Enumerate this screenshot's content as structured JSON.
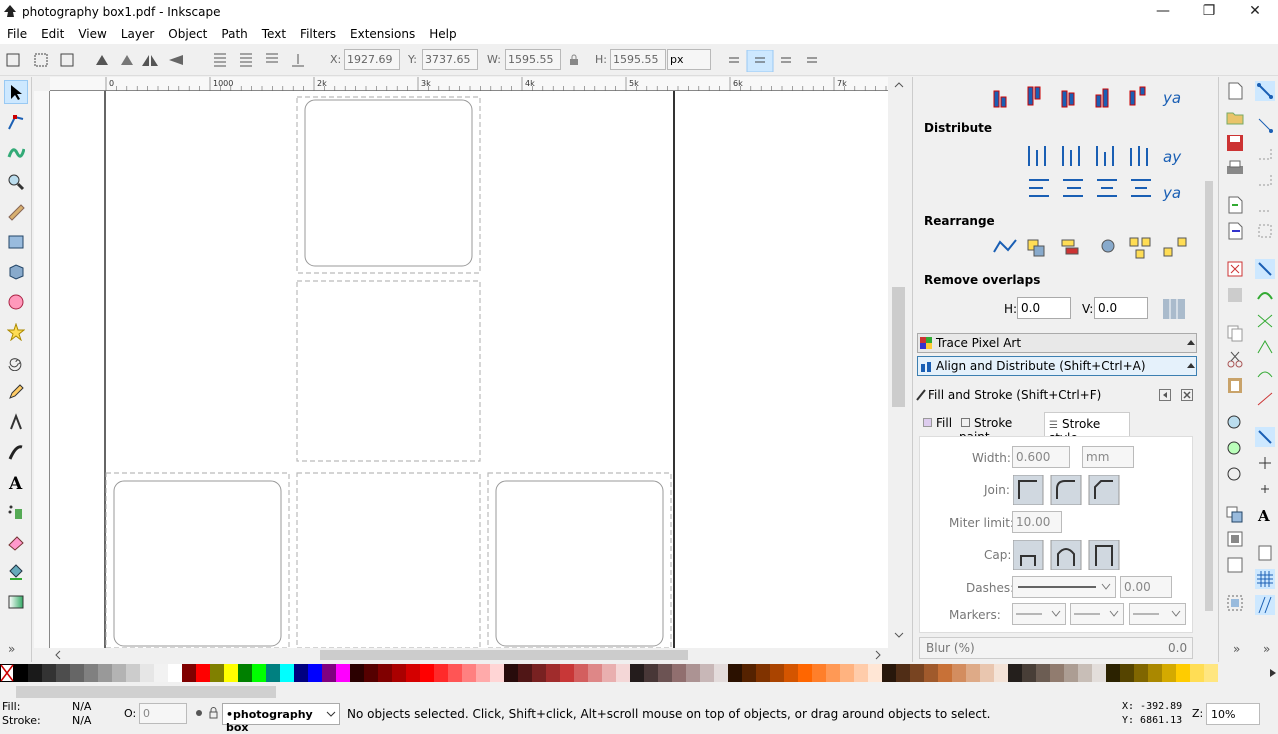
{
  "window": {
    "title": "photography box1.pdf - Inkscape",
    "minimize": "—",
    "maximize": "❐",
    "close": "✕"
  },
  "menu": [
    "File",
    "Edit",
    "View",
    "Layer",
    "Object",
    "Path",
    "Text",
    "Filters",
    "Extensions",
    "Help"
  ],
  "toolbar": {
    "x_label": "X:",
    "x_value": "1927.69",
    "y_label": "Y:",
    "y_value": "3737.65",
    "w_label": "W:",
    "w_value": "1595.55",
    "h_label": "H:",
    "h_value": "1595.55",
    "unit": "px"
  },
  "ruler": {
    "h_ticks": [
      "0",
      "1000",
      "2k",
      "3k",
      "4k",
      "5k",
      "6k",
      "7k"
    ],
    "v_ticks": [
      "7",
      "",
      "",
      ""
    ]
  },
  "dock": {
    "align": {
      "distribute": "Distribute",
      "rearrange": "Rearrange",
      "remove_overlaps": "Remove overlaps",
      "h_label": "H:",
      "h_value": "0.0",
      "v_label": "V:",
      "v_value": "0.0"
    },
    "trace_panel": "Trace Pixel Art",
    "align_panel": "Align and Distribute (Shift+Ctrl+A)",
    "fill_stroke": {
      "title": "Fill and Stroke (Shift+Ctrl+F)",
      "tabs": [
        "Fill",
        "Stroke paint",
        "Stroke style"
      ],
      "width_label": "Width:",
      "width_value": "0.600",
      "width_unit": "mm",
      "join_label": "Join:",
      "miter_label": "Miter limit:",
      "miter_value": "10.00",
      "cap_label": "Cap:",
      "dashes_label": "Dashes:",
      "dashes_value": "0.00",
      "markers_label": "Markers:",
      "blur_label": "Blur (%)",
      "blur_value": "0.0"
    }
  },
  "status": {
    "fill_label": "Fill:",
    "fill_value": "N/A",
    "stroke_label": "Stroke:",
    "stroke_value": "N/A",
    "opacity_label": "O:",
    "opacity_value": "0",
    "layer": "•photography box",
    "message": "No objects selected. Click, Shift+click, Alt+scroll mouse on top of objects, or drag around objects to select.",
    "x_coord": "X: -392.89",
    "y_coord": "Y: 6861.13",
    "zoom_label": "Z:",
    "zoom_value": "10%"
  },
  "colors": {
    "accent": "#cde8ff",
    "palette_bar": "#f0f0f0"
  },
  "palette": [
    "#000000",
    "#1a1a1a",
    "#333333",
    "#4d4d4d",
    "#666666",
    "#808080",
    "#999999",
    "#b3b3b3",
    "#cccccc",
    "#e6e6e6",
    "#f2f2f2",
    "#ffffff",
    "#800000",
    "#ff0000",
    "#808000",
    "#ffff00",
    "#008000",
    "#00ff00",
    "#008080",
    "#00ffff",
    "#000080",
    "#0000ff",
    "#800080",
    "#ff00ff",
    "#2b0000",
    "#550000",
    "#800000",
    "#aa0000",
    "#d40000",
    "#ff0000",
    "#ff2a2a",
    "#ff5555",
    "#ff8080",
    "#ffaaaa",
    "#ffd5d5",
    "#280b0b",
    "#501616",
    "#782121",
    "#a02c2c",
    "#c83737",
    "#d35f5f",
    "#de8787",
    "#e9afaf",
    "#f4d7d7",
    "#241c1c",
    "#483737",
    "#6c5353",
    "#916f6f",
    "#ac9393",
    "#c8b7b7",
    "#e3dbdb",
    "#2b1100",
    "#552200",
    "#803300",
    "#aa4400",
    "#d45500",
    "#ff6600",
    "#ff7f2a",
    "#ff9955",
    "#ffb380",
    "#ffccaa",
    "#ffe6d5",
    "#28170b",
    "#502d16",
    "#784421",
    "#a05a2c",
    "#c87137",
    "#d38d5f",
    "#deaa87",
    "#e9c6af",
    "#f4e3d7",
    "#241f1c",
    "#483e37",
    "#6c5d53",
    "#917c6f",
    "#ac9d93",
    "#c8beb7",
    "#e3dedb",
    "#2b2200",
    "#554400",
    "#806600",
    "#aa8800",
    "#d4aa00",
    "#ffcc00",
    "#ffdd55",
    "#ffe680"
  ]
}
